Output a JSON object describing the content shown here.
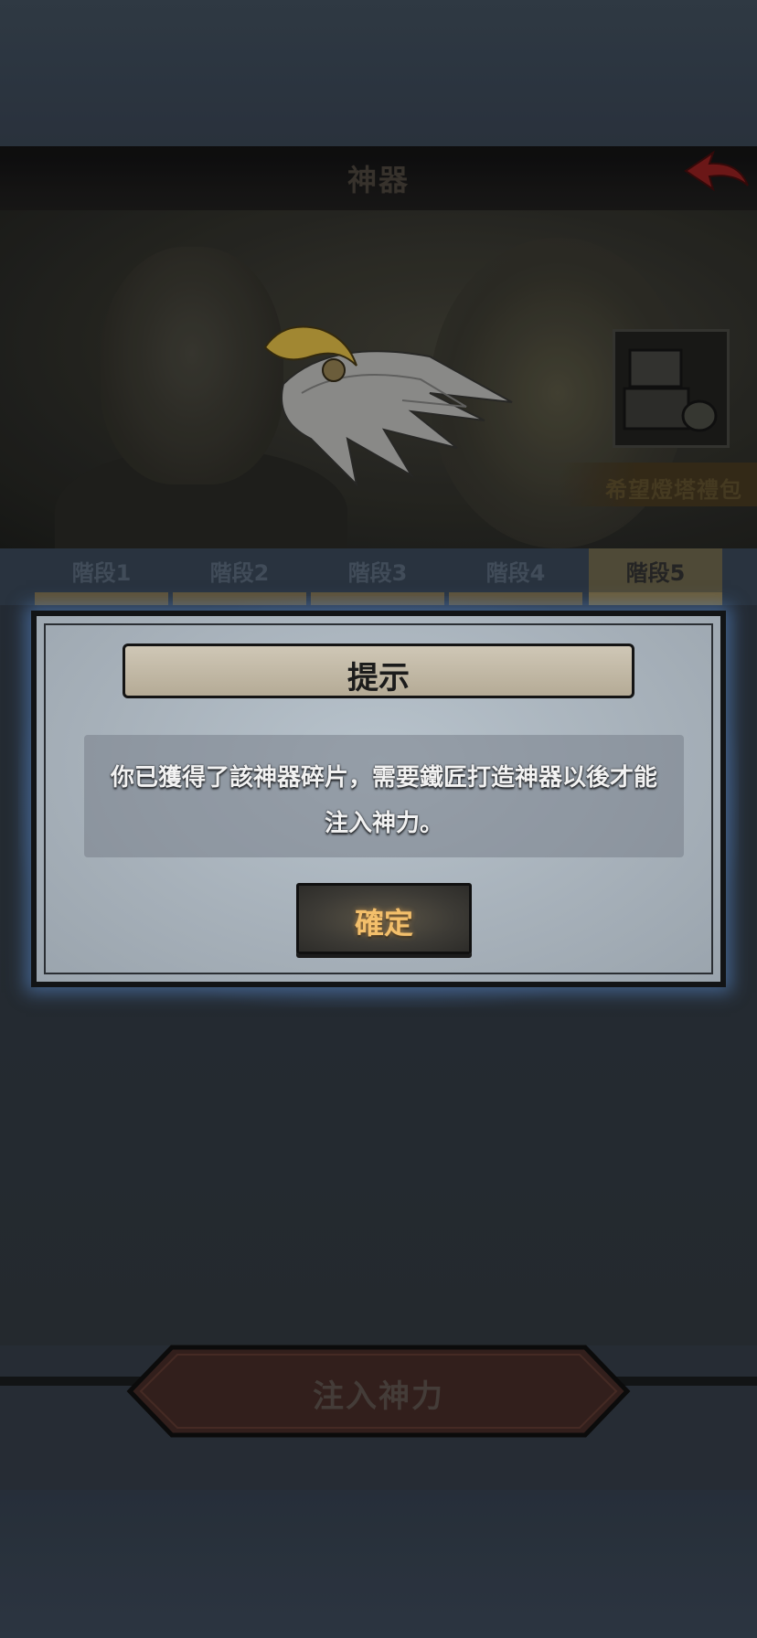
{
  "header": {
    "title": "神器"
  },
  "promo": {
    "gift_pack_label": "希望燈塔禮包"
  },
  "stages": {
    "tabs": [
      {
        "label": "階段1",
        "active": false
      },
      {
        "label": "階段2",
        "active": false
      },
      {
        "label": "階段3",
        "active": false
      },
      {
        "label": "階段4",
        "active": false
      },
      {
        "label": "階段5",
        "active": true
      }
    ]
  },
  "actions": {
    "inject_label": "注入神力"
  },
  "dialog": {
    "title": "提示",
    "message": "你已獲得了該神器碎片，需要鐵匠打造神器以後才能注入神力。",
    "confirm_label": "確定"
  },
  "colors": {
    "accent_gold": "#f3bf6b",
    "dialog_glow": "#5a8cd2",
    "back_arrow": "#8a1e1e"
  }
}
